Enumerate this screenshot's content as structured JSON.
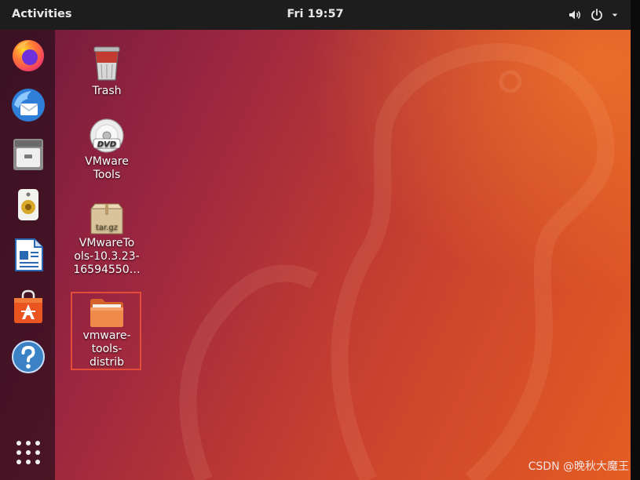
{
  "topbar": {
    "activities_label": "Activities",
    "clock": "Fri 19:57",
    "icons": [
      "volume-icon",
      "power-icon",
      "dropdown-arrow-icon"
    ]
  },
  "dock": {
    "items": [
      "firefox",
      "thunderbird",
      "files",
      "rhythmbox",
      "libreoffice-writer",
      "ubuntu-software",
      "help",
      "show-applications"
    ]
  },
  "desktop": {
    "icons": [
      {
        "label": "Trash",
        "icon": "trash-icon"
      },
      {
        "label": "VMware Tools",
        "label_lines": [
          "VMware",
          "Tools"
        ],
        "icon": "dvd-icon"
      },
      {
        "label_lines": [
          "VMwareTo",
          "ols-10.3.23-",
          "16594550…"
        ],
        "icon": "archive-icon",
        "badge": "tar.gz"
      },
      {
        "label_lines": [
          "vmware-",
          "tools-",
          "distrib"
        ],
        "icon": "folder-icon",
        "selected": true
      }
    ]
  },
  "watermark": "CSDN @晚秋大魔王",
  "colors": {
    "topbar": "#1d1d1d",
    "wallpaper_dark": "#6f1a3c",
    "wallpaper_light": "#e45d22",
    "selection": "#e34b3b"
  }
}
